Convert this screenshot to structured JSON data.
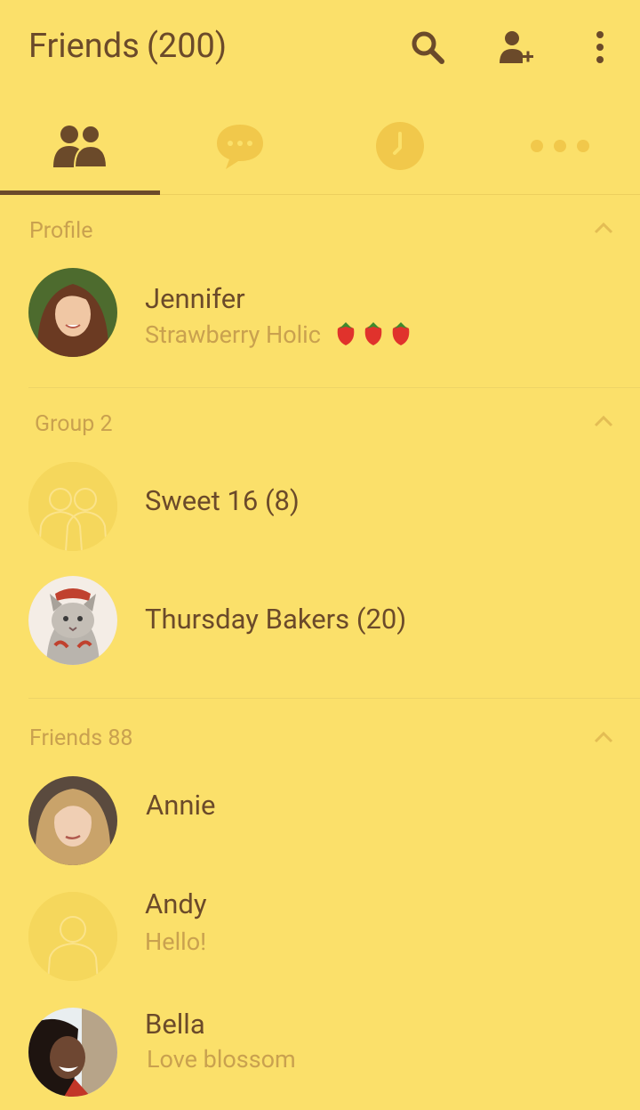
{
  "header": {
    "title": "Friends",
    "count": "(200)"
  },
  "actions": [
    "search-icon",
    "add-friend-icon",
    "more-vert-icon"
  ],
  "tabs": [
    {
      "name": "friends",
      "icon": "people-icon",
      "active": true
    },
    {
      "name": "chats",
      "icon": "chat-bubble-icon",
      "active": false
    },
    {
      "name": "recent",
      "icon": "clock-icon",
      "active": false
    },
    {
      "name": "more",
      "icon": "more-horiz-icon",
      "active": false
    }
  ],
  "profile": {
    "title": "Profile",
    "name": "Jennifer",
    "status": "Strawberry Holic"
  },
  "groups": {
    "title": "Group 2",
    "items": [
      {
        "name": "Sweet 16 (8)"
      },
      {
        "name": "Thursday Bakers (20)"
      }
    ]
  },
  "friends": {
    "title": "Friends 88",
    "items": [
      {
        "name": "Annie",
        "status": ""
      },
      {
        "name": "Andy",
        "status": "Hello!"
      },
      {
        "name": "Bella",
        "status": "Love blossom"
      }
    ]
  },
  "colors": {
    "background": "#fbe06a",
    "primary": "#6b4a2a",
    "secondary": "#c9a14f",
    "muted_icon": "#f1c84b"
  }
}
